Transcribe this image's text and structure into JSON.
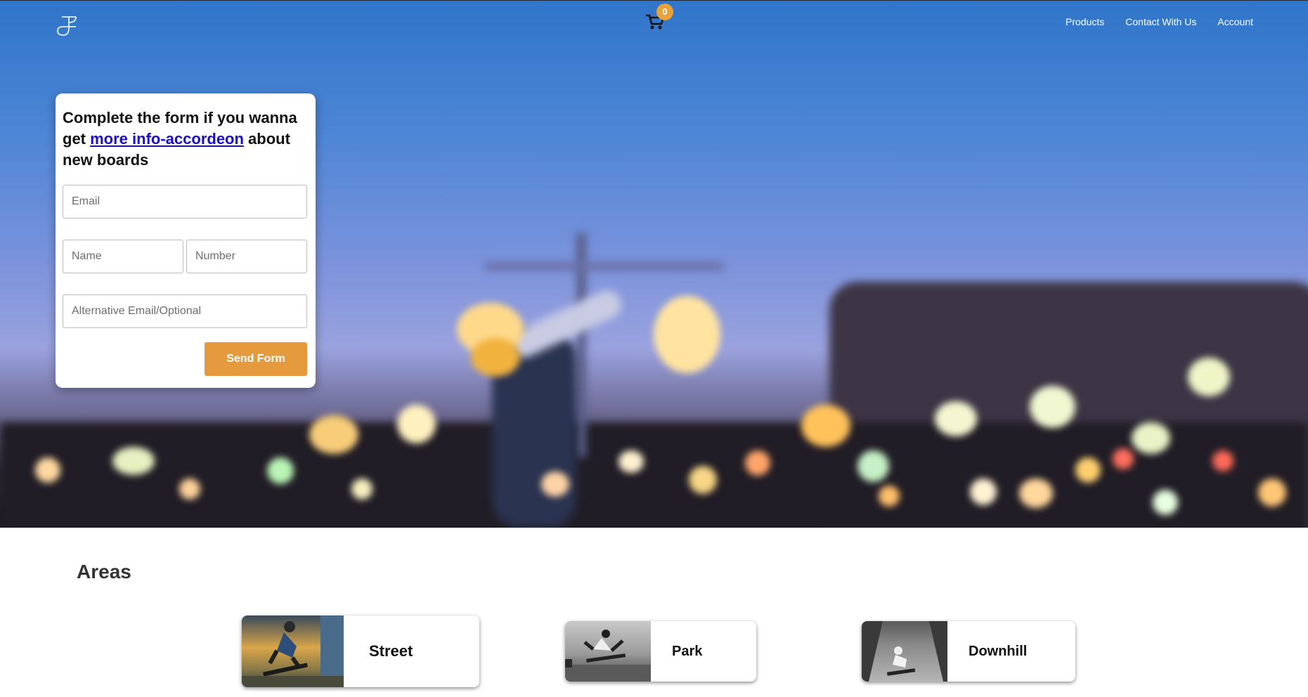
{
  "nav": {
    "cart_count": "0",
    "links": [
      "Products",
      "Contact With Us",
      "Account"
    ]
  },
  "form": {
    "title_before": "Complete the form if you wanna get ",
    "title_link": "more info-accordeon",
    "title_after": " about new boards",
    "email_placeholder": "Email",
    "name_placeholder": "Name",
    "number_placeholder": "Number",
    "alt_email_placeholder": "Alternative Email/Optional",
    "submit_label": "Send Form"
  },
  "areas": {
    "title": "Areas",
    "items": [
      {
        "label": "Street"
      },
      {
        "label": "Park"
      },
      {
        "label": "Downhill"
      }
    ]
  },
  "colors": {
    "accent": "#e69a3e",
    "badge": "#e8a23a",
    "link": "#1a0dcc"
  },
  "icons": [
    "logo-icon",
    "cart-icon"
  ]
}
